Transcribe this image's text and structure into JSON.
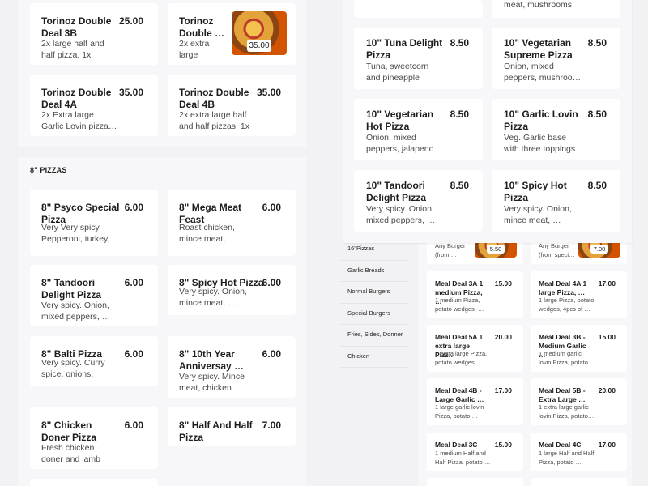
{
  "left_window": {
    "top_cards": [
      {
        "name": "Torinoz Double Deal 3B",
        "price": "25.00",
        "desc": "2x large half and half pizza, 1x Larg…"
      },
      {
        "name": "Torinoz Double …",
        "price": "35.00",
        "desc": "2x extra large pizzas…",
        "has_image": true
      },
      {
        "name": "Torinoz Double Deal 4A",
        "price": "35.00",
        "desc": "2x Extra large Garlic Lovin pizza…"
      },
      {
        "name": "Torinoz Double Deal 4B",
        "price": "35.00",
        "desc": "2x extra large half and half pizzas, 1x …"
      }
    ],
    "section_title": "8\" PIZZAS",
    "pizza_cards": [
      {
        "name": "8\" Psyco Special Pizza",
        "price": "6.00",
        "desc": "Very Very spicy. Pepperoni, turkey, …"
      },
      {
        "name": "8\" Mega Meat Feast",
        "price": "6.00",
        "desc": "Roast chicken, mince meat, pepperoni, …"
      },
      {
        "name": "8\" Tandoori Delight Pizza",
        "price": "6.00",
        "desc": "Very spicy. Onion, mixed peppers, …"
      },
      {
        "name": "8\" Spicy Hot Pizza",
        "price": "6.00",
        "desc": "Very spicy. Onion, mince meat, …"
      },
      {
        "name": "8\" Balti Pizza",
        "price": "6.00",
        "desc": "Very spicy. Curry spice, onions, mixe…"
      },
      {
        "name": "8\" 10th Year Anniversay …",
        "price": "6.00",
        "desc": "Very spicy. Mince meat, chicken breas…"
      },
      {
        "name": "8\" Chicken Doner Pizza",
        "price": "6.00",
        "desc": "Fresh chicken doner and lamb doner …"
      },
      {
        "name": "8\" Half And Half Pizza",
        "price": "7.00",
        "desc": ""
      }
    ]
  },
  "right_window": {
    "top_partial_desc": "meat, mushrooms …",
    "cards": [
      {
        "name": "10\" Tuna Delight Pizza",
        "price": "8.50",
        "desc": "Tuna, sweetcorn and pineapple"
      },
      {
        "name": "10\" Vegetarian Supreme Pizza",
        "price": "8.50",
        "desc": "Onion, mixed peppers, mushroo…"
      },
      {
        "name": "10\" Vegetarian Hot Pizza",
        "price": "8.50",
        "desc": "Onion, mixed peppers, jalapeno …"
      },
      {
        "name": "10\" Garlic Lovin Pizza",
        "price": "8.50",
        "desc": "Veg. Garlic base with three toppings of …"
      },
      {
        "name": "10\" Tandoori Delight Pizza",
        "price": "8.50",
        "desc": "Very spicy. Onion, mixed peppers, …"
      },
      {
        "name": "10\" Spicy Hot Pizza",
        "price": "8.50",
        "desc": "Very spicy. Onion, mince meat, …"
      }
    ]
  },
  "small_window": {
    "categories": [
      "16\"Pizzas",
      "Garlic Breads",
      "Normal Burgers",
      "Special Burgers",
      "Fries, Sides, Donner",
      "Chicken"
    ],
    "top_cards": [
      {
        "desc": "Any Burger (from …",
        "price_tag": "5.50"
      },
      {
        "desc": "Any Burger (from speci…",
        "price_tag": "7.00"
      }
    ],
    "cards": [
      {
        "name": "Meal Deal 3A 1 medium Pizza, …",
        "price": "15.00",
        "desc": "1 medium Pizza, potato wedges, …"
      },
      {
        "name": "Meal Deal 4A 1 large Pizza, …",
        "price": "17.00",
        "desc": "1 large Pizza, potato wedges, 4pcs of …"
      },
      {
        "name": "Meal Deal 5A 1 extra large Pizz…",
        "price": "20.00",
        "desc": "1 extra large Pizza, potato wedges, …"
      },
      {
        "name": "Meal Deal 3B - Medium Garlic …",
        "price": "15.00",
        "desc": "1 medium garlic lovin Pizza, potato…"
      },
      {
        "name": "Meal Deal 4B - Large Garlic …",
        "price": "17.00",
        "desc": "1 large garlic lovin Pizza, potato …"
      },
      {
        "name": "Meal Deal 5B - Extra Large …",
        "price": "20.00",
        "desc": "1 extra large garlic lovin Pizza, potato…"
      },
      {
        "name": "Meal Deal 3C",
        "price": "15.00",
        "desc": "1 medium Half and Half Pizza, potato …"
      },
      {
        "name": "Meal Deal 4C",
        "price": "17.00",
        "desc": "1 large Half and Half Pizza, potato …"
      }
    ]
  },
  "colors": {
    "background": "#f2f2f4",
    "card": "#ffffff",
    "text": "#1d1d1d",
    "muted": "#4a4a4a"
  }
}
